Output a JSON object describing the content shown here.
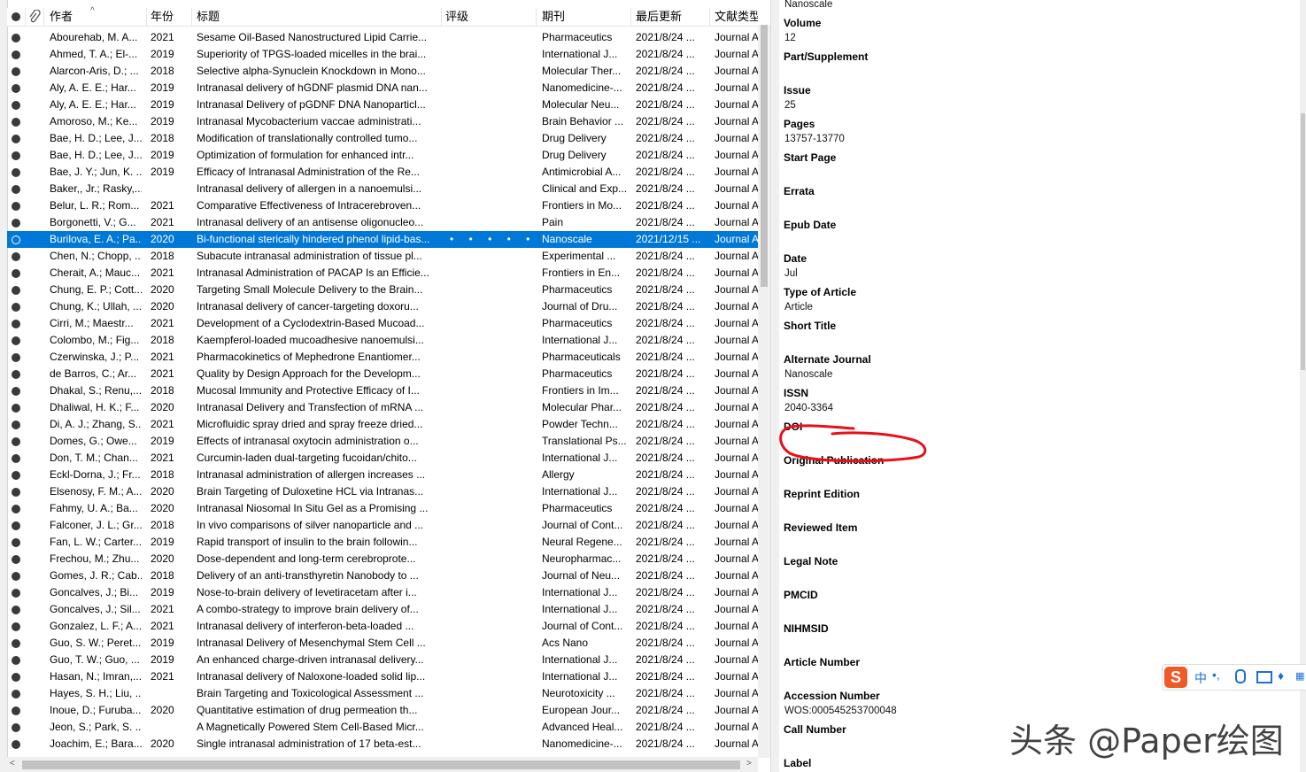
{
  "columns": {
    "author": "作者",
    "year": "年份",
    "title": "标题",
    "rating": "评级",
    "journal": "期刊",
    "updated": "最后更新",
    "reftype": "文献类型"
  },
  "rows": [
    {
      "author": "Abourehab, M. A...",
      "year": "2021",
      "title": "Sesame Oil-Based Nanostructured Lipid Carrie...",
      "journal": "Pharmaceutics",
      "updated": "2021/8/24 ...",
      "type": "Journal A"
    },
    {
      "author": "Ahmed, T. A.; El-...",
      "year": "2019",
      "title": "Superiority of TPGS-loaded micelles in the brai...",
      "journal": "International J...",
      "updated": "2021/8/24 ...",
      "type": "Journal A"
    },
    {
      "author": "Alarcon-Aris, D.; ...",
      "year": "2018",
      "title": "Selective alpha-Synuclein Knockdown in Mono...",
      "journal": "Molecular Ther...",
      "updated": "2021/8/24 ...",
      "type": "Journal A"
    },
    {
      "author": "Aly, A. E. E.; Har...",
      "year": "2019",
      "title": "Intranasal delivery of hGDNF plasmid DNA nan...",
      "journal": "Nanomedicine-...",
      "updated": "2021/8/24 ...",
      "type": "Journal A"
    },
    {
      "author": "Aly, A. E. E.; Har...",
      "year": "2019",
      "title": "Intranasal Delivery of pGDNF DNA Nanoparticl...",
      "journal": "Molecular Neu...",
      "updated": "2021/8/24 ...",
      "type": "Journal A"
    },
    {
      "author": "Amoroso, M.; Ke...",
      "year": "2019",
      "title": "Intranasal Mycobacterium vaccae administrati...",
      "journal": "Brain Behavior ...",
      "updated": "2021/8/24 ...",
      "type": "Journal A"
    },
    {
      "author": "Bae, H. D.; Lee, J....",
      "year": "2018",
      "title": "Modification of translationally controlled tumo...",
      "journal": "Drug Delivery",
      "updated": "2021/8/24 ...",
      "type": "Journal A"
    },
    {
      "author": "Bae, H. D.; Lee, J....",
      "year": "2019",
      "title": "Optimization of formulation for enhanced intr...",
      "journal": "Drug Delivery",
      "updated": "2021/8/24 ...",
      "type": "Journal A"
    },
    {
      "author": "Bae, J. Y.; Jun, K. ...",
      "year": "2019",
      "title": "Efficacy of Intranasal Administration of the Re...",
      "journal": "Antimicrobial A...",
      "updated": "2021/8/24 ...",
      "type": "Journal A"
    },
    {
      "author": "Baker,, Jr.; Rasky,...",
      "year": "",
      "title": "Intranasal delivery of allergen in a nanoemulsi...",
      "journal": "Clinical and Exp...",
      "updated": "2021/8/24 ...",
      "type": "Journal A"
    },
    {
      "author": "Belur, L. R.; Rom...",
      "year": "2021",
      "title": "Comparative Effectiveness of Intracerebroven...",
      "journal": "Frontiers in Mo...",
      "updated": "2021/8/24 ...",
      "type": "Journal A"
    },
    {
      "author": "Borgonetti, V.; G...",
      "year": "2021",
      "title": "Intranasal delivery of an antisense oligonucleo...",
      "journal": "Pain",
      "updated": "2021/8/24 ...",
      "type": "Journal A"
    },
    {
      "author": "Burilova, E. A.; Pa...",
      "year": "2020",
      "title": "Bi-functional sterically hindered phenol lipid-bas...",
      "journal": "Nanoscale",
      "updated": "2021/12/15 ...",
      "type": "Journal A",
      "selected": true
    },
    {
      "author": "Chen, N.; Chopp, ...",
      "year": "2018",
      "title": "Subacute intranasal administration of tissue pl...",
      "journal": "Experimental ...",
      "updated": "2021/8/24 ...",
      "type": "Journal A"
    },
    {
      "author": "Cherait, A.; Mauc...",
      "year": "2021",
      "title": "Intranasal Administration of PACAP Is an Efficie...",
      "journal": "Frontiers in En...",
      "updated": "2021/8/24 ...",
      "type": "Journal A"
    },
    {
      "author": "Chung, E. P.; Cott...",
      "year": "2020",
      "title": "Targeting Small Molecule Delivery to the Brain...",
      "journal": "Pharmaceutics",
      "updated": "2021/8/24 ...",
      "type": "Journal A"
    },
    {
      "author": "Chung, K.; Ullah, ...",
      "year": "2020",
      "title": "Intranasal delivery of cancer-targeting doxoru...",
      "journal": "Journal of Dru...",
      "updated": "2021/8/24 ...",
      "type": "Journal A"
    },
    {
      "author": "Cirri, M.; Maestr...",
      "year": "2021",
      "title": "Development of a Cyclodextrin-Based Mucoad...",
      "journal": "Pharmaceutics",
      "updated": "2021/8/24 ...",
      "type": "Journal A"
    },
    {
      "author": "Colombo, M.; Fig...",
      "year": "2018",
      "title": "Kaempferol-loaded mucoadhesive nanoemulsi...",
      "journal": "International J...",
      "updated": "2021/8/24 ...",
      "type": "Journal A"
    },
    {
      "author": "Czerwinska, J.; P...",
      "year": "2021",
      "title": "Pharmacokinetics of Mephedrone Enantiomer...",
      "journal": "Pharmaceuticals",
      "updated": "2021/8/24 ...",
      "type": "Journal A"
    },
    {
      "author": "de Barros, C.; Ar...",
      "year": "2021",
      "title": "Quality by Design Approach for the Developm...",
      "journal": "Pharmaceutics",
      "updated": "2021/8/24 ...",
      "type": "Journal A"
    },
    {
      "author": "Dhakal, S.; Renu,...",
      "year": "2018",
      "title": "Mucosal Immunity and Protective Efficacy of I...",
      "journal": "Frontiers in Im...",
      "updated": "2021/8/24 ...",
      "type": "Journal A"
    },
    {
      "author": "Dhaliwal, H. K.; F...",
      "year": "2020",
      "title": "Intranasal Delivery and Transfection of mRNA ...",
      "journal": "Molecular Phar...",
      "updated": "2021/8/24 ...",
      "type": "Journal A"
    },
    {
      "author": "Di, A. J.; Zhang, S...",
      "year": "2021",
      "title": "Microfluidic spray dried and spray freeze dried...",
      "journal": "Powder Techn...",
      "updated": "2021/8/24 ...",
      "type": "Journal A"
    },
    {
      "author": "Domes, G.; Owe...",
      "year": "2019",
      "title": "Effects of intranasal oxytocin administration o...",
      "journal": "Translational Ps...",
      "updated": "2021/8/24 ...",
      "type": "Journal A"
    },
    {
      "author": "Don, T. M.; Chan...",
      "year": "2021",
      "title": "Curcumin-laden dual-targeting fucoidan/chito...",
      "journal": "International J...",
      "updated": "2021/8/24 ...",
      "type": "Journal A"
    },
    {
      "author": "Eckl-Dorna, J.; Fr...",
      "year": "2018",
      "title": "Intranasal administration of allergen increases ...",
      "journal": "Allergy",
      "updated": "2021/8/24 ...",
      "type": "Journal A"
    },
    {
      "author": "Elsenosy, F. M.; A...",
      "year": "2020",
      "title": "Brain Targeting of Duloxetine HCL via Intranas...",
      "journal": "International J...",
      "updated": "2021/8/24 ...",
      "type": "Journal A"
    },
    {
      "author": "Fahmy, U. A.; Ba...",
      "year": "2020",
      "title": "Intranasal Niosomal In Situ Gel as a Promising ...",
      "journal": "Pharmaceutics",
      "updated": "2021/8/24 ...",
      "type": "Journal A"
    },
    {
      "author": "Falconer, J. L.; Gr...",
      "year": "2018",
      "title": "In vivo comparisons of silver nanoparticle and ...",
      "journal": "Journal of Cont...",
      "updated": "2021/8/24 ...",
      "type": "Journal A"
    },
    {
      "author": "Fan, L. W.; Carter...",
      "year": "2019",
      "title": "Rapid transport of insulin to the brain followin...",
      "journal": "Neural Regene...",
      "updated": "2021/8/24 ...",
      "type": "Journal A"
    },
    {
      "author": "Frechou, M.; Zhu...",
      "year": "2020",
      "title": "Dose-dependent and long-term cerebroprote...",
      "journal": "Neuropharmac...",
      "updated": "2021/8/24 ...",
      "type": "Journal A"
    },
    {
      "author": "Gomes, J. R.; Cab...",
      "year": "2018",
      "title": "Delivery of an anti-transthyretin Nanobody to ...",
      "journal": "Journal of Neu...",
      "updated": "2021/8/24 ...",
      "type": "Journal A"
    },
    {
      "author": "Goncalves, J.; Bi...",
      "year": "2019",
      "title": "Nose-to-brain delivery of levetiracetam after i...",
      "journal": "International J...",
      "updated": "2021/8/24 ...",
      "type": "Journal A"
    },
    {
      "author": "Goncalves, J.; Sil...",
      "year": "2021",
      "title": "A combo-strategy to improve brain delivery of...",
      "journal": "International J...",
      "updated": "2021/8/24 ...",
      "type": "Journal A"
    },
    {
      "author": "Gonzalez, L. F.; A...",
      "year": "2021",
      "title": "Intranasal delivery of interferon-beta-loaded ...",
      "journal": "Journal of Cont...",
      "updated": "2021/8/24 ...",
      "type": "Journal A"
    },
    {
      "author": "Guo, S. W.; Peret...",
      "year": "2019",
      "title": "Intranasal Delivery of Mesenchymal Stem Cell ...",
      "journal": "Acs Nano",
      "updated": "2021/8/24 ...",
      "type": "Journal A"
    },
    {
      "author": "Guo, T. W.; Guo, ...",
      "year": "2019",
      "title": "An enhanced charge-driven intranasal delivery...",
      "journal": "International J...",
      "updated": "2021/8/24 ...",
      "type": "Journal A"
    },
    {
      "author": "Hasan, N.; Imran,...",
      "year": "2021",
      "title": "Intranasal delivery of Naloxone-loaded solid lip...",
      "journal": "International J...",
      "updated": "2021/8/24 ...",
      "type": "Journal A"
    },
    {
      "author": "Hayes, S. H.; Liu, ...",
      "year": "",
      "title": "Brain Targeting and Toxicological Assessment ...",
      "journal": "Neurotoxicity ...",
      "updated": "2021/8/24 ...",
      "type": "Journal A"
    },
    {
      "author": "Inoue, D.; Furuba...",
      "year": "2020",
      "title": "Quantitative estimation of drug permeation th...",
      "journal": "European Jour...",
      "updated": "2021/8/24 ...",
      "type": "Journal A"
    },
    {
      "author": "Jeon, S.; Park, S. ...",
      "year": "",
      "title": "A Magnetically Powered Stem Cell-Based Micr...",
      "journal": "Advanced Heal...",
      "updated": "2021/8/24 ...",
      "type": "Journal A"
    },
    {
      "author": "Joachim, E.; Bara...",
      "year": "2020",
      "title": "Single intranasal administration of 17 beta-est...",
      "journal": "Nanomedicine-...",
      "updated": "2021/8/24 ...",
      "type": "Journal A"
    }
  ],
  "selected_rating": "• • • • •",
  "details": {
    "top_value": "Nanoscale",
    "fields": [
      {
        "label": "Volume",
        "value": "12"
      },
      {
        "label": "Part/Supplement",
        "value": ""
      },
      {
        "label": "Issue",
        "value": "25"
      },
      {
        "label": "Pages",
        "value": "13757-13770"
      },
      {
        "label": "Start Page",
        "value": ""
      },
      {
        "label": "Errata",
        "value": ""
      },
      {
        "label": "Epub Date",
        "value": ""
      },
      {
        "label": "Date",
        "value": "Jul"
      },
      {
        "label": "Type of Article",
        "value": "Article"
      },
      {
        "label": "Short Title",
        "value": ""
      },
      {
        "label": "Alternate Journal",
        "value": "Nanoscale"
      },
      {
        "label": "ISSN",
        "value": "2040-3364"
      },
      {
        "label": "DOI",
        "value": ""
      },
      {
        "label": "Original Publication",
        "value": ""
      },
      {
        "label": "Reprint Edition",
        "value": ""
      },
      {
        "label": "Reviewed Item",
        "value": ""
      },
      {
        "label": "Legal Note",
        "value": ""
      },
      {
        "label": "PMCID",
        "value": ""
      },
      {
        "label": "NIHMSID",
        "value": ""
      },
      {
        "label": "Article Number",
        "value": ""
      },
      {
        "label": "Accession Number",
        "value": "WOS:000545253700048"
      },
      {
        "label": "Call Number",
        "value": ""
      },
      {
        "label": "Label",
        "value": ""
      }
    ]
  },
  "ime_toolbar": {
    "logo": "S",
    "lang": "中"
  },
  "watermark": "头条 @Paper绘图",
  "colors": {
    "selection": "#0078d7",
    "annotation": "#e8101a"
  }
}
